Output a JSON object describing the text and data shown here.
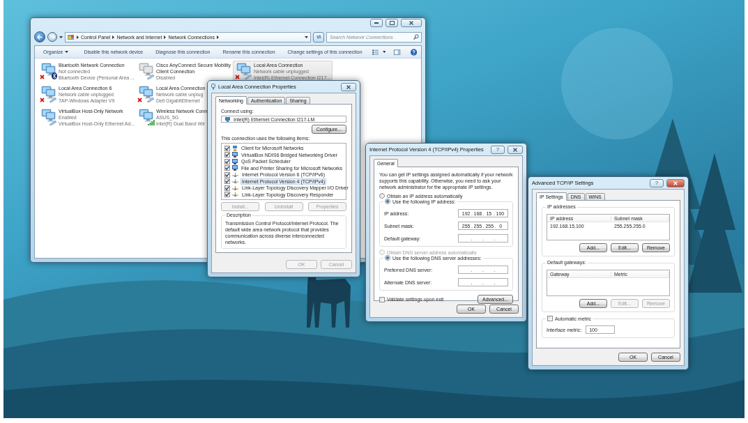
{
  "explorer": {
    "address": [
      "Control Panel",
      "Network and Internet",
      "Network Connections"
    ],
    "search": {
      "placeholder": "Search Network Connections"
    },
    "toolbar": [
      {
        "label": "Organize",
        "menu": true
      },
      {
        "label": "Disable this network device",
        "menu": false
      },
      {
        "label": "Diagnose this connection",
        "menu": false
      },
      {
        "label": "Rename this connection",
        "menu": false
      },
      {
        "label": "Change settings of this connection",
        "menu": false
      }
    ],
    "connection_rows": [
      [
        {
          "name": "Bluetooth Network Connection",
          "status": "Not connected",
          "device": "Bluetooth Device (Personal Area ...",
          "kind": "bluetooth",
          "error": true,
          "selected": false
        },
        {
          "name": "Cisco AnyConnect Secure Mobility Client Connection",
          "status": "Disabled",
          "kind": "disabled",
          "error": false,
          "selected": false
        },
        {
          "name": "Local Area Connection",
          "status": "Network cable unplugged",
          "device": "Intel(R) Ethernet Connection I217...",
          "kind": "wired",
          "error": true,
          "selected": true
        }
      ],
      [
        {
          "name": "Local Area Connection 6",
          "status": "Network cable unplugged",
          "device": "TAP-Windows Adapter V9",
          "kind": "wired",
          "error": true,
          "selected": false
        },
        {
          "name": "Local Area Connection",
          "status": "Network cable unplug",
          "device": "Dell GigabitEthernet",
          "kind": "wired",
          "error": true,
          "selected": false
        }
      ],
      [
        {
          "name": "VirtualBox Host-Only Network",
          "status": "Enabled",
          "device": "VirtualBox Host-Only Ethernet Ad...",
          "kind": "wired",
          "error": false,
          "selected": false
        },
        {
          "name": "Wireless Network Conn",
          "status": "ASUS_5G",
          "device": "Intel(R) Dual Band Wir",
          "kind": "wireless",
          "error": false,
          "selected": false
        }
      ]
    ]
  },
  "properties": {
    "title": "Local Area Connection Properties",
    "tabs": [
      {
        "label": "Networking",
        "selected": true
      },
      {
        "label": "Authentication",
        "selected": false
      },
      {
        "label": "Sharing",
        "selected": false
      }
    ],
    "connect_using_label": "Connect using:",
    "adapter": "Intel(R) Ethernet Connection I217-LM",
    "configure_button": "Configure...",
    "items_label": "This connection uses the following items:",
    "items": [
      {
        "label": "Client for Microsoft Networks",
        "checked": true,
        "selected": false,
        "kind": "client"
      },
      {
        "label": "VirtualBox NDIS6 Bridged Networking Driver",
        "checked": true,
        "selected": false,
        "kind": "service"
      },
      {
        "label": "QoS Packet Scheduler",
        "checked": true,
        "selected": false,
        "kind": "service"
      },
      {
        "label": "File and Printer Sharing for Microsoft Networks",
        "checked": true,
        "selected": false,
        "kind": "service"
      },
      {
        "label": "Internet Protocol Version 6 (TCP/IPv6)",
        "checked": true,
        "selected": false,
        "kind": "protocol"
      },
      {
        "label": "Internet Protocol Version 4 (TCP/IPv4)",
        "checked": true,
        "selected": true,
        "kind": "protocol"
      },
      {
        "label": "Link-Layer Topology Discovery Mapper I/O Driver",
        "checked": true,
        "selected": false,
        "kind": "protocol"
      },
      {
        "label": "Link-Layer Topology Discovery Responder",
        "checked": true,
        "selected": false,
        "kind": "protocol"
      }
    ],
    "item_buttons": [
      {
        "label": "Install...",
        "disabled": true
      },
      {
        "label": "Uninstall",
        "disabled": true
      },
      {
        "label": "Properties",
        "disabled": true
      }
    ],
    "description": {
      "label": "Description",
      "text": "Transmission Control Protocol/Internet Protocol. The default wide area network protocol that provides communication across diverse interconnected networks."
    },
    "buttons": [
      {
        "label": "OK",
        "disabled": true
      },
      {
        "label": "Cancel",
        "disabled": true
      }
    ]
  },
  "ipv4": {
    "title": "Internet Protocol Version 4 (TCP/IPv4) Properties",
    "help": "?",
    "tabs": [
      {
        "label": "General",
        "selected": true
      }
    ],
    "intro": "You can get IP settings assigned automatically if your network supports this capability. Otherwise, you need to ask your network administrator for the appropriate IP settings.",
    "ip_mode": [
      {
        "label": "Obtain an IP address automatically",
        "selected": false,
        "disabled": false
      },
      {
        "label": "Use the following IP address:",
        "selected": true,
        "disabled": false
      }
    ],
    "ip_fields": [
      {
        "label": "IP address:",
        "octets": [
          "192",
          "168",
          "15",
          "100"
        ]
      },
      {
        "label": "Subnet mask:",
        "octets": [
          "255",
          "255",
          "255",
          "0"
        ]
      },
      {
        "label": "Default gateway:"
      }
    ],
    "dns_mode": [
      {
        "label": "Obtain DNS server address automatically",
        "selected": false,
        "disabled": true
      },
      {
        "label": "Use the following DNS server addresses:",
        "selected": true,
        "disabled": false
      }
    ],
    "dns_fields": [
      {
        "label": "Preferred DNS server:"
      },
      {
        "label": "Alternate DNS server:"
      }
    ],
    "separator": ".",
    "validate": {
      "label": "Validate settings upon exit",
      "checked": false
    },
    "advanced_button": "Advanced...",
    "buttons": [
      {
        "label": "OK",
        "disabled": false
      },
      {
        "label": "Cancel",
        "disabled": false
      }
    ]
  },
  "advanced": {
    "title": "Advanced TCP/IP Settings",
    "help": "?",
    "tabs": [
      {
        "label": "IP Settings",
        "selected": true
      },
      {
        "label": "DNS",
        "selected": false
      },
      {
        "label": "WINS",
        "selected": false
      }
    ],
    "ip_group": {
      "label": "IP addresses",
      "columns": [
        "IP address",
        "Subnet mask"
      ],
      "rows": [
        [
          "192.168.15.100",
          "255.255.255.0"
        ]
      ],
      "buttons": [
        {
          "label": "Add...",
          "disabled": false
        },
        {
          "label": "Edit...",
          "disabled": false
        },
        {
          "label": "Remove",
          "disabled": false
        }
      ]
    },
    "gateway_group": {
      "label": "Default gateways:",
      "columns": [
        "Gateway",
        "Metric"
      ],
      "buttons": [
        {
          "label": "Add...",
          "disabled": false
        },
        {
          "label": "Edit...",
          "disabled": true
        },
        {
          "label": "Remove",
          "disabled": true
        }
      ]
    },
    "automatic_metric": {
      "label": "Automatic metric",
      "checked": false
    },
    "interface_metric": {
      "label": "Interface metric:",
      "value": "100"
    },
    "buttons": [
      {
        "label": "OK",
        "disabled": false
      },
      {
        "label": "Cancel",
        "disabled": false
      }
    ]
  }
}
